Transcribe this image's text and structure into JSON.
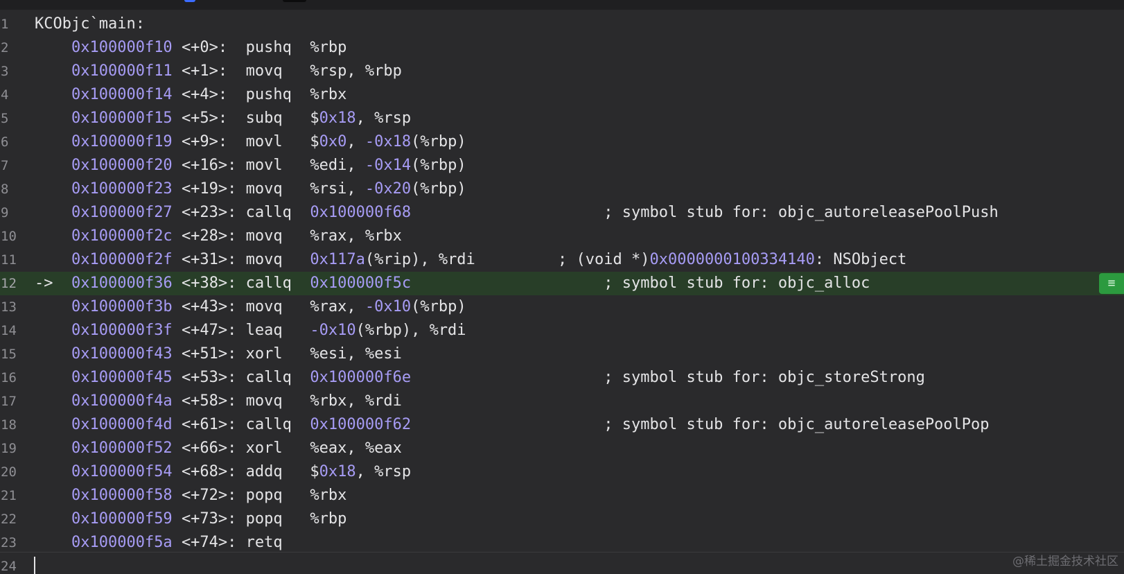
{
  "editor": {
    "title_line": "KCObjc`main:",
    "instruction_pointer": "->",
    "current_line": 12,
    "lines": [
      {
        "n": "1"
      },
      {
        "n": "2",
        "addr": "0x100000f10",
        "off": "<+0>:  ",
        "op": "pushq  ",
        "args": [
          [
            "t",
            "%rbp"
          ]
        ]
      },
      {
        "n": "3",
        "addr": "0x100000f11",
        "off": "<+1>:  ",
        "op": "movq   ",
        "args": [
          [
            "t",
            "%rsp, %rbp"
          ]
        ]
      },
      {
        "n": "4",
        "addr": "0x100000f14",
        "off": "<+4>:  ",
        "op": "pushq  ",
        "args": [
          [
            "t",
            "%rbx"
          ]
        ]
      },
      {
        "n": "5",
        "addr": "0x100000f15",
        "off": "<+5>:  ",
        "op": "subq   ",
        "args": [
          [
            "t",
            "$"
          ],
          [
            "n",
            "0x18"
          ],
          [
            "t",
            ", %rsp"
          ]
        ]
      },
      {
        "n": "6",
        "addr": "0x100000f19",
        "off": "<+9>:  ",
        "op": "movl   ",
        "args": [
          [
            "t",
            "$"
          ],
          [
            "n",
            "0x0"
          ],
          [
            "t",
            ", "
          ],
          [
            "n",
            "-0x18"
          ],
          [
            "t",
            "(%rbp)"
          ]
        ]
      },
      {
        "n": "7",
        "addr": "0x100000f20",
        "off": "<+16>: ",
        "op": "movl   ",
        "args": [
          [
            "t",
            "%edi, "
          ],
          [
            "n",
            "-0x14"
          ],
          [
            "t",
            "(%rbp)"
          ]
        ]
      },
      {
        "n": "8",
        "addr": "0x100000f23",
        "off": "<+19>: ",
        "op": "movq   ",
        "args": [
          [
            "t",
            "%rsi, "
          ],
          [
            "n",
            "-0x20"
          ],
          [
            "t",
            "(%rbp)"
          ]
        ]
      },
      {
        "n": "9",
        "addr": "0x100000f27",
        "off": "<+23>: ",
        "op": "callq  ",
        "args": [
          [
            "n",
            "0x100000f68"
          ],
          [
            "t",
            "                     "
          ]
        ],
        "comment": [
          [
            "t",
            "; symbol stub for: objc_autoreleasePoolPush"
          ]
        ]
      },
      {
        "n": "10",
        "addr": "0x100000f2c",
        "off": "<+28>: ",
        "op": "movq   ",
        "args": [
          [
            "t",
            "%rax, %rbx"
          ]
        ]
      },
      {
        "n": "11",
        "addr": "0x100000f2f",
        "off": "<+31>: ",
        "op": "movq   ",
        "args": [
          [
            "n",
            "0x117a"
          ],
          [
            "t",
            "(%rip), %rdi         "
          ]
        ],
        "comment": [
          [
            "t",
            "; (void *)"
          ],
          [
            "n",
            "0x0000000100334140"
          ],
          [
            "t",
            ": NSObject"
          ]
        ]
      },
      {
        "n": "12",
        "addr": "0x100000f36",
        "off": "<+38>: ",
        "op": "callq  ",
        "args": [
          [
            "n",
            "0x100000f5c"
          ],
          [
            "t",
            "                     "
          ]
        ],
        "comment": [
          [
            "t",
            "; symbol stub for: objc_alloc"
          ]
        ]
      },
      {
        "n": "13",
        "addr": "0x100000f3b",
        "off": "<+43>: ",
        "op": "movq   ",
        "args": [
          [
            "t",
            "%rax, "
          ],
          [
            "n",
            "-0x10"
          ],
          [
            "t",
            "(%rbp)"
          ]
        ]
      },
      {
        "n": "14",
        "addr": "0x100000f3f",
        "off": "<+47>: ",
        "op": "leaq   ",
        "args": [
          [
            "n",
            "-0x10"
          ],
          [
            "t",
            "(%rbp), %rdi"
          ]
        ]
      },
      {
        "n": "15",
        "addr": "0x100000f43",
        "off": "<+51>: ",
        "op": "xorl   ",
        "args": [
          [
            "t",
            "%esi, %esi"
          ]
        ]
      },
      {
        "n": "16",
        "addr": "0x100000f45",
        "off": "<+53>: ",
        "op": "callq  ",
        "args": [
          [
            "n",
            "0x100000f6e"
          ],
          [
            "t",
            "                     "
          ]
        ],
        "comment": [
          [
            "t",
            "; symbol stub for: objc_storeStrong"
          ]
        ]
      },
      {
        "n": "17",
        "addr": "0x100000f4a",
        "off": "<+58>: ",
        "op": "movq   ",
        "args": [
          [
            "t",
            "%rbx, %rdi"
          ]
        ]
      },
      {
        "n": "18",
        "addr": "0x100000f4d",
        "off": "<+61>: ",
        "op": "callq  ",
        "args": [
          [
            "n",
            "0x100000f62"
          ],
          [
            "t",
            "                     "
          ]
        ],
        "comment": [
          [
            "t",
            "; symbol stub for: objc_autoreleasePoolPop"
          ]
        ]
      },
      {
        "n": "19",
        "addr": "0x100000f52",
        "off": "<+66>: ",
        "op": "xorl   ",
        "args": [
          [
            "t",
            "%eax, %eax"
          ]
        ]
      },
      {
        "n": "20",
        "addr": "0x100000f54",
        "off": "<+68>: ",
        "op": "addq   ",
        "args": [
          [
            "t",
            "$"
          ],
          [
            "n",
            "0x18"
          ],
          [
            "t",
            ", %rsp"
          ]
        ]
      },
      {
        "n": "21",
        "addr": "0x100000f58",
        "off": "<+72>: ",
        "op": "popq   ",
        "args": [
          [
            "t",
            "%rbx"
          ]
        ]
      },
      {
        "n": "22",
        "addr": "0x100000f59",
        "off": "<+73>: ",
        "op": "popq   ",
        "args": [
          [
            "t",
            "%rbp"
          ]
        ]
      },
      {
        "n": "23",
        "addr": "0x100000f5a",
        "off": "<+74>: ",
        "op": "retq",
        "args": []
      },
      {
        "n": "24"
      }
    ]
  },
  "marker_icon": "hamburger-icon",
  "marker_glyph": "≡",
  "watermark": "@稀土掘金技术社区",
  "colors": {
    "background": "#2a2a2c",
    "text": "#e4e4e6",
    "address": "#a79cf5",
    "current_line": "#283e28",
    "marker": "#2c9a3f"
  }
}
